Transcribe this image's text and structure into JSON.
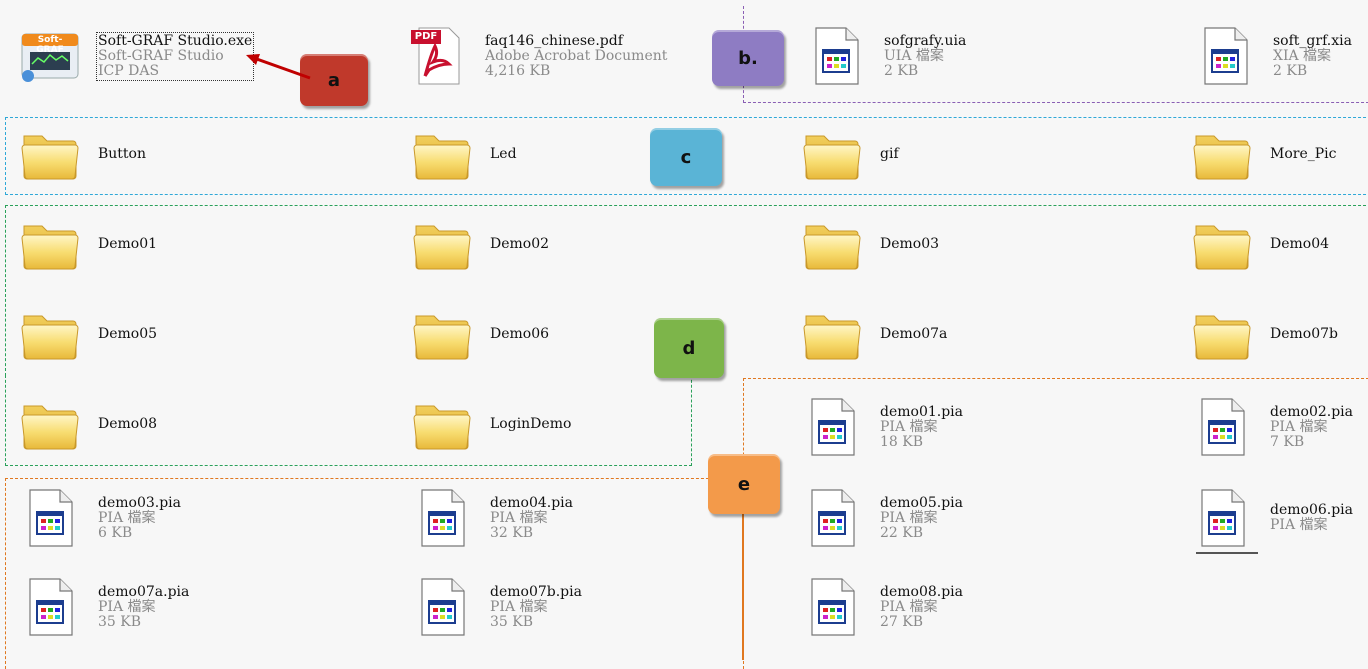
{
  "colors": {
    "region_b": "#8a5fb4",
    "region_c": "#2fa8d8",
    "region_d": "#2aa15a",
    "region_e": "#e07820",
    "badge_a": "#c0392b",
    "badge_b": "#8e7cc3",
    "badge_c": "#5ab4d6",
    "badge_d": "#7db54a",
    "badge_e": "#f39a4a",
    "arrow": "#c00000"
  },
  "badges": {
    "a": "a",
    "b": "b.",
    "c": "c",
    "d": "d",
    "e": "e"
  },
  "files": {
    "softgraf": {
      "name": "Soft-GRAF Studio.exe",
      "line2": "Soft-GRAF Studio",
      "line3": "ICP DAS",
      "icon": "softgraf-app-icon",
      "icon_text": "Soft-GRAF"
    },
    "faq": {
      "name": "faq146_chinese.pdf",
      "line2": "Adobe Acrobat Document",
      "line3": "4,216 KB",
      "icon": "pdf-icon",
      "icon_text": "PDF"
    },
    "sofgrafy": {
      "name": "sofgrafy.uia",
      "line2": "UIA 檔案",
      "line3": "2 KB",
      "icon": "document-icon"
    },
    "softgrfxia": {
      "name": "soft_grf.xia",
      "line2": "XIA 檔案",
      "line3": "2 KB",
      "icon": "document-icon"
    }
  },
  "resource_folders": [
    "Button",
    "Led",
    "gif",
    "More_Pic"
  ],
  "demo_folders": [
    "Demo01",
    "Demo02",
    "Demo03",
    "Demo04",
    "Demo05",
    "Demo06",
    "Demo07a",
    "Demo07b",
    "Demo08",
    "LoginDemo"
  ],
  "pia_files": [
    {
      "name": "demo01.pia",
      "type": "PIA 檔案",
      "size": "18 KB"
    },
    {
      "name": "demo02.pia",
      "type": "PIA 檔案",
      "size": "7 KB"
    },
    {
      "name": "demo03.pia",
      "type": "PIA 檔案",
      "size": "6 KB"
    },
    {
      "name": "demo04.pia",
      "type": "PIA 檔案",
      "size": "32 KB"
    },
    {
      "name": "demo05.pia",
      "type": "PIA 檔案",
      "size": "22 KB"
    },
    {
      "name": "demo06.pia",
      "type": "PIA 檔案",
      "size": ""
    },
    {
      "name": "demo07a.pia",
      "type": "PIA 檔案",
      "size": "35 KB"
    },
    {
      "name": "demo07b.pia",
      "type": "PIA 檔案",
      "size": "35 KB"
    },
    {
      "name": "demo08.pia",
      "type": "PIA 檔案",
      "size": "27 KB"
    }
  ]
}
